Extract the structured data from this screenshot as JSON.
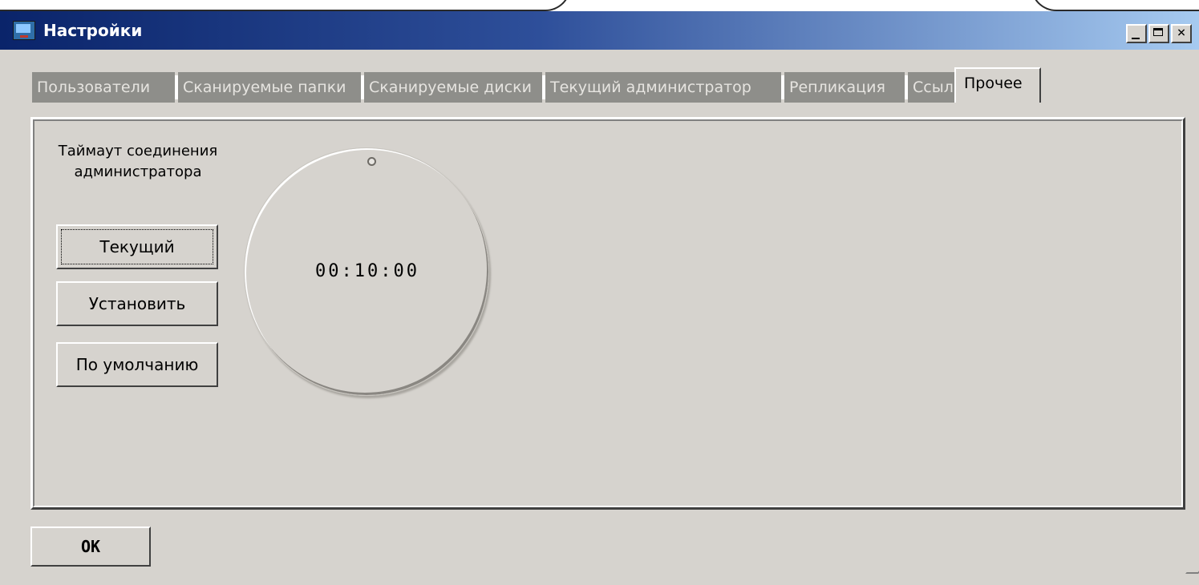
{
  "window": {
    "title": "Настройки",
    "title_icon": "monitor-icon",
    "controls": [
      "minimize",
      "maximize",
      "close"
    ]
  },
  "tabs": [
    {
      "label": "Пользователи",
      "active": false
    },
    {
      "label": "Сканируемые папки",
      "active": false
    },
    {
      "label": "Сканируемые диски",
      "active": false
    },
    {
      "label": "Текущий администратор",
      "active": false
    },
    {
      "label": "Репликация",
      "active": false
    },
    {
      "label": "Ссылки",
      "active": false
    },
    {
      "label": "Прочее",
      "active": true
    }
  ],
  "timeout": {
    "label": "Таймаут соединения администратора",
    "value": "00:10:00",
    "buttons": {
      "current": "Текущий",
      "set": "Установить",
      "default": "По умолчанию"
    }
  },
  "footer": {
    "ok_label": "OK"
  },
  "colors": {
    "title_start": "#0a246a",
    "title_end": "#a6caf0",
    "face": "#d6d3ce",
    "inactive_tab": "#8e8e8a"
  }
}
